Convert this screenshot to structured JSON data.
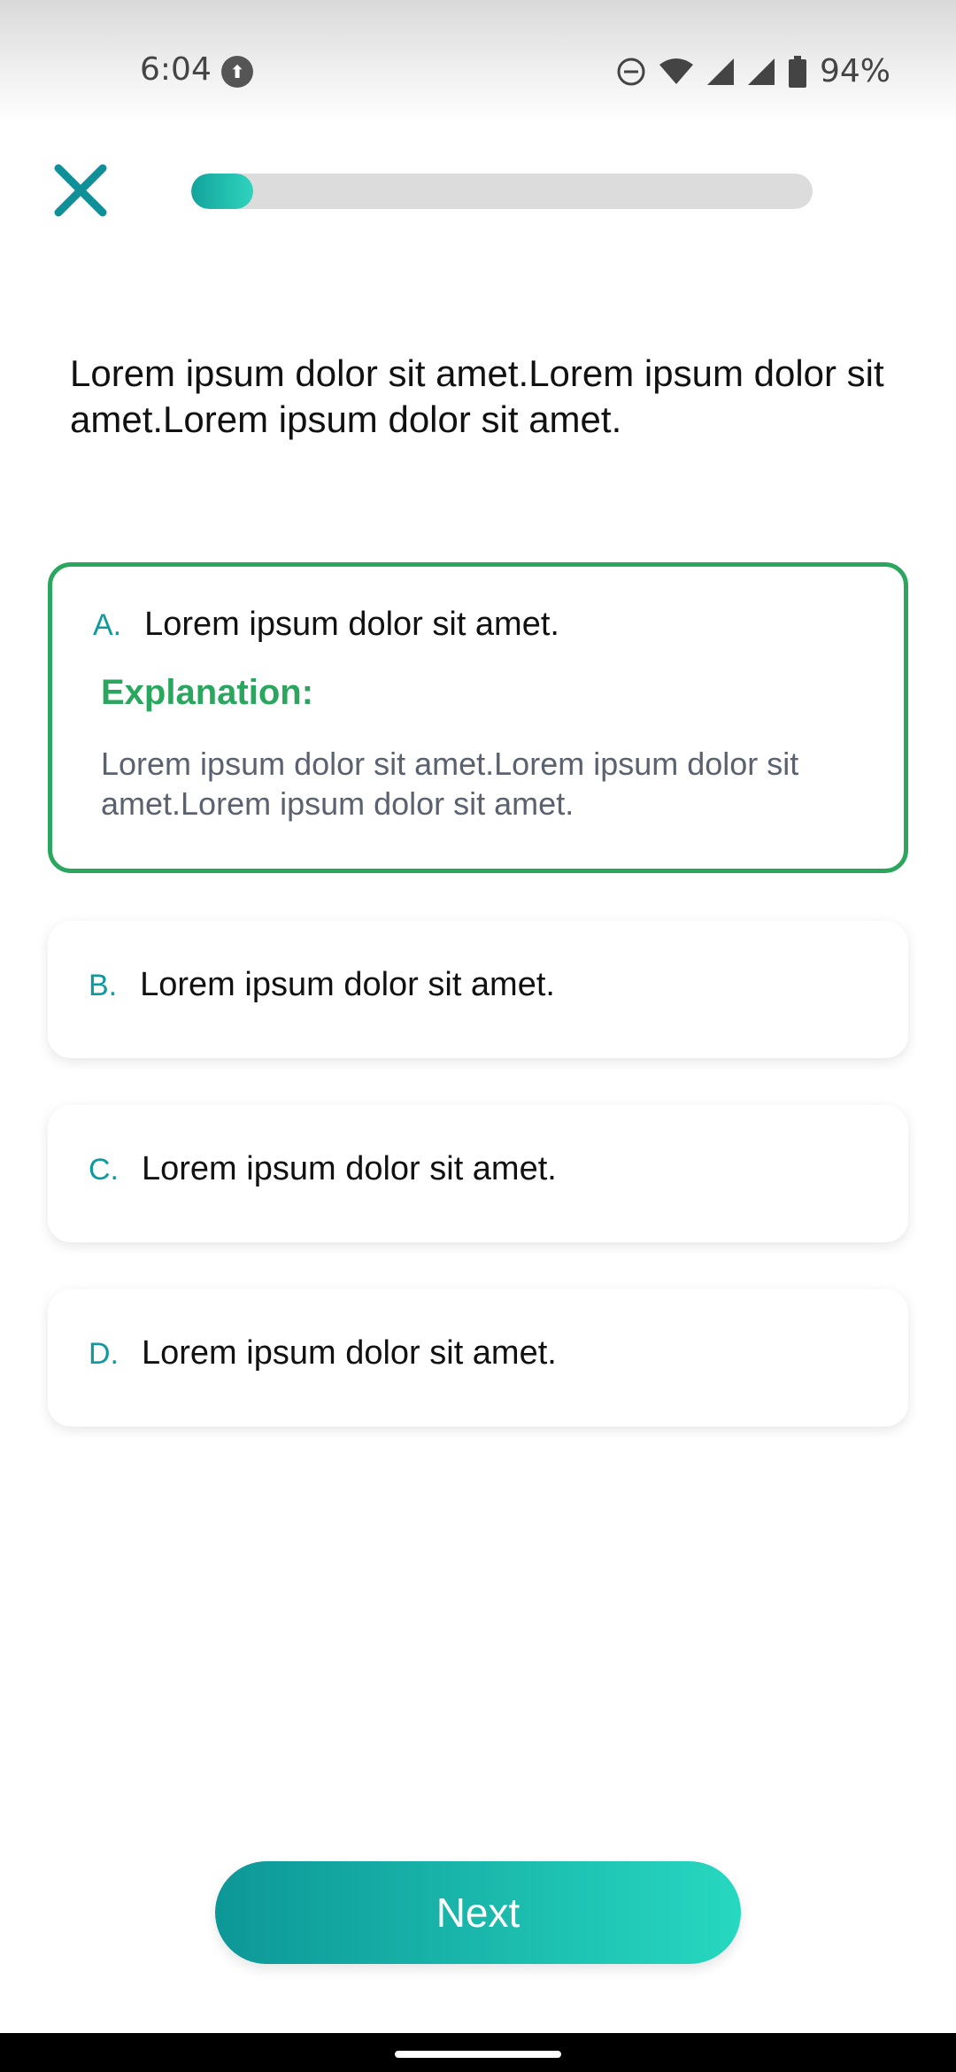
{
  "status_bar": {
    "time": "6:04",
    "app_icon_glyph": "⬆",
    "battery_text": "94%",
    "icons": [
      "do-not-disturb-icon",
      "wifi-icon",
      "signal-icon",
      "signal-icon",
      "battery-icon"
    ]
  },
  "header": {
    "close_icon": "close-icon",
    "progress_fraction": 0.1
  },
  "question": {
    "text": "Lorem ipsum dolor sit amet.Lorem ipsum dolor sit amet.Lorem ipsum dolor sit amet."
  },
  "options": [
    {
      "letter": "A.",
      "text": "Lorem ipsum dolor sit amet.",
      "selected": true,
      "explanation_title": "Explanation:",
      "explanation_text": "Lorem ipsum dolor sit amet.Lorem ipsum dolor sit amet.Lorem ipsum dolor sit amet."
    },
    {
      "letter": "B.",
      "text": "Lorem ipsum dolor sit amet."
    },
    {
      "letter": "C.",
      "text": "Lorem ipsum dolor sit amet."
    },
    {
      "letter": "D.",
      "text": "Lorem ipsum dolor sit amet."
    }
  ],
  "footer": {
    "next_label": "Next"
  },
  "colors": {
    "accent": "#0f9aa0",
    "correct": "#2ba65f",
    "progress_start": "#12a49e",
    "progress_end": "#2fd3bc"
  }
}
